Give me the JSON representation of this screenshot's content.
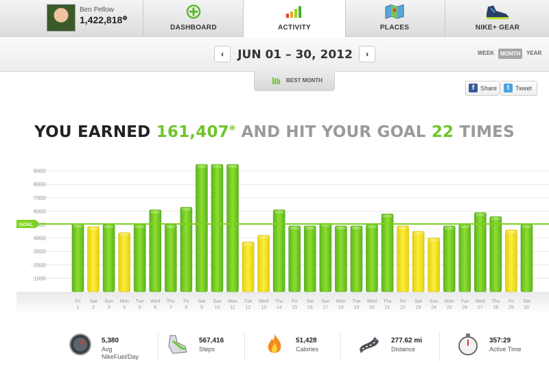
{
  "profile": {
    "name": "Ben Pellow",
    "points": "1,422,818"
  },
  "nav": {
    "tabs": [
      {
        "label": "DASHBOARD"
      },
      {
        "label": "ACTIVITY"
      },
      {
        "label": "PLACES"
      },
      {
        "label": "NIKE+ GEAR"
      }
    ]
  },
  "datebar": {
    "prev": "‹",
    "next": "›",
    "range": "JUN 01 – 30, 2012",
    "periods": {
      "week": "WEEK",
      "month": "MONTH",
      "year": "YEAR"
    }
  },
  "best_month": "BEST MONTH",
  "share": {
    "facebook": "Share",
    "twitter": "Tweet"
  },
  "headline": {
    "part1": "YOU EARNED ",
    "fuel": "161,407",
    "part2": " AND HIT YOUR GOAL ",
    "count": "22",
    "part3": " TIMES"
  },
  "colors": {
    "green": "#6fc52a",
    "yellow": "#f1de1b",
    "goal": "#7ed321"
  },
  "chart_data": {
    "type": "bar",
    "goal": 5000,
    "goal_label": "GOAL",
    "ylim": [
      0,
      10000
    ],
    "yticks": [
      1000,
      2000,
      3000,
      4000,
      5000,
      6000,
      7000,
      8000,
      9000
    ],
    "days": [
      {
        "dow": "Fri",
        "day": "1",
        "value": 5050,
        "hit": true
      },
      {
        "dow": "Sat",
        "day": "2",
        "value": 4850,
        "hit": false
      },
      {
        "dow": "Sun",
        "day": "3",
        "value": 5000,
        "hit": true
      },
      {
        "dow": "Mon",
        "day": "4",
        "value": 4400,
        "hit": false
      },
      {
        "dow": "Tue",
        "day": "5",
        "value": 5000,
        "hit": true
      },
      {
        "dow": "Wed",
        "day": "6",
        "value": 6100,
        "hit": true
      },
      {
        "dow": "Thu",
        "day": "7",
        "value": 5000,
        "hit": true
      },
      {
        "dow": "Fri",
        "day": "8",
        "value": 6300,
        "hit": true
      },
      {
        "dow": "Sat",
        "day": "9",
        "value": 9600,
        "hit": true
      },
      {
        "dow": "Sun",
        "day": "10",
        "value": 10100,
        "hit": true
      },
      {
        "dow": "Mon",
        "day": "11",
        "value": 9600,
        "hit": true
      },
      {
        "dow": "Tue",
        "day": "12",
        "value": 3700,
        "hit": false
      },
      {
        "dow": "Wed",
        "day": "13",
        "value": 4200,
        "hit": false
      },
      {
        "dow": "Thu",
        "day": "14",
        "value": 6100,
        "hit": true
      },
      {
        "dow": "Fri",
        "day": "15",
        "value": 4900,
        "hit": true
      },
      {
        "dow": "Sat",
        "day": "16",
        "value": 4900,
        "hit": true
      },
      {
        "dow": "Sun",
        "day": "17",
        "value": 5100,
        "hit": true
      },
      {
        "dow": "Mon",
        "day": "18",
        "value": 4900,
        "hit": true
      },
      {
        "dow": "Tue",
        "day": "19",
        "value": 4900,
        "hit": true
      },
      {
        "dow": "Wed",
        "day": "20",
        "value": 5000,
        "hit": true
      },
      {
        "dow": "Thu",
        "day": "21",
        "value": 5800,
        "hit": true
      },
      {
        "dow": "Fri",
        "day": "22",
        "value": 4900,
        "hit": false
      },
      {
        "dow": "Sat",
        "day": "23",
        "value": 4500,
        "hit": false
      },
      {
        "dow": "Sun",
        "day": "24",
        "value": 4000,
        "hit": false
      },
      {
        "dow": "Mon",
        "day": "25",
        "value": 4900,
        "hit": true
      },
      {
        "dow": "Tue",
        "day": "26",
        "value": 5000,
        "hit": true
      },
      {
        "dow": "Wed",
        "day": "27",
        "value": 5900,
        "hit": true
      },
      {
        "dow": "Thu",
        "day": "28",
        "value": 5600,
        "hit": true
      },
      {
        "dow": "Fri",
        "day": "29",
        "value": 4600,
        "hit": false
      },
      {
        "dow": "Sat",
        "day": "30",
        "value": 5000,
        "hit": true
      }
    ]
  },
  "stats": [
    {
      "value": "5,380",
      "label": "Avg\nNikeFuel/Day",
      "icon": "fuel-gauge-icon"
    },
    {
      "value": "567,416",
      "label": "Steps",
      "icon": "shoe-icon"
    },
    {
      "value": "51,428",
      "label": "Calories",
      "icon": "flame-icon"
    },
    {
      "value": "277.62 mi",
      "label": "Distance",
      "icon": "road-icon"
    },
    {
      "value": "357:29",
      "label": "Active Time",
      "icon": "stopwatch-icon"
    }
  ]
}
